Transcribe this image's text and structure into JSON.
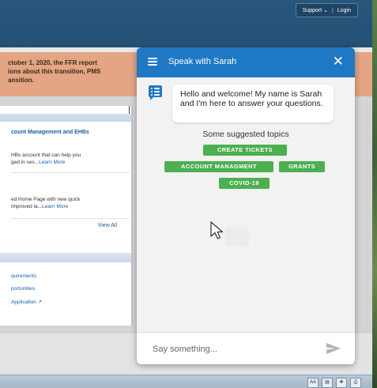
{
  "header": {
    "support_label": "Support ⌄",
    "login_label": "Login",
    "separator": "|"
  },
  "alert": {
    "lines": [
      "ctober 1, 2020, the FFR report",
      "ions about this transition, PMS",
      "ansition."
    ]
  },
  "card": {
    "section1_title": "count Management and EHBs",
    "item1_lines": [
      "HBs account that can help you",
      "ged in ses..."
    ],
    "item1_link": "Learn More",
    "item2_lines": [
      "ed Home Page with new quick",
      " improved la..."
    ],
    "item2_link": "Learn More",
    "view_all": "View All",
    "links": [
      "quirements",
      "portunities",
      "Application ↗"
    ]
  },
  "status_icons": [
    "AA",
    "▤",
    "❖",
    "⎙"
  ],
  "chat": {
    "title": "Speak with Sarah",
    "close_glyph": "✕",
    "welcome_message": "Hello and welcome! My name is Sarah and I'm here to answer your questions.",
    "topics_heading": "Some suggested topics",
    "topics": [
      "CREATE TICKETS",
      "ACCOUNT MANAGMENT",
      "GRANTS",
      "COVID-19"
    ],
    "input_placeholder": "Say something...",
    "accent_color": "#1f78c4",
    "chip_color": "#4caf50"
  }
}
